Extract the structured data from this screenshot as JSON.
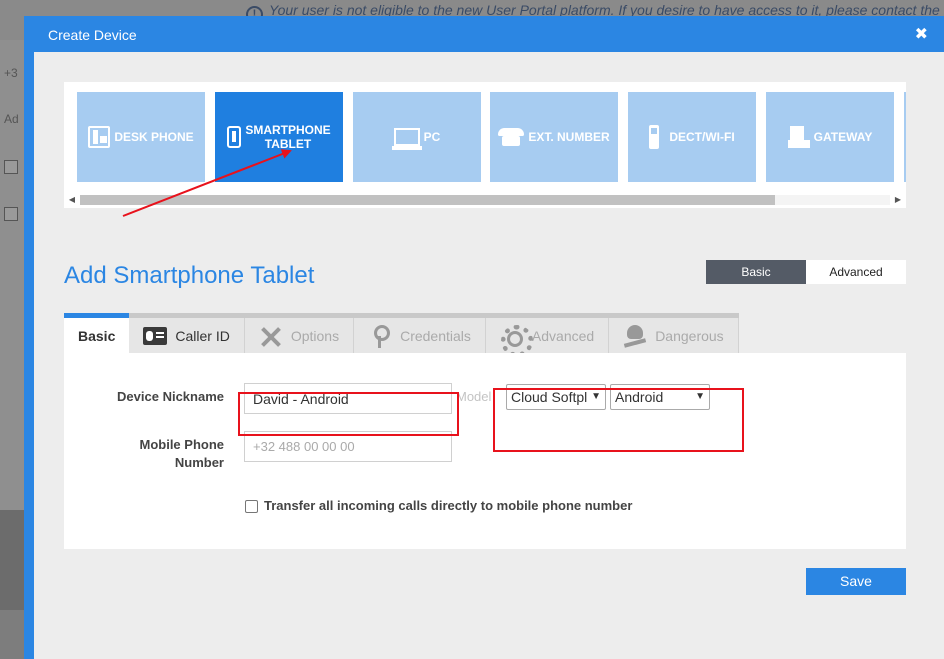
{
  "background": {
    "notice": "Your user is not eligible to the new User Portal platform. If you desire to have access to it, please contact the",
    "left_fragments": [
      "+3",
      "Ad"
    ]
  },
  "modal": {
    "title": "Create Device",
    "close_glyph": "✖"
  },
  "device_types": [
    {
      "label": "DESK PHONE",
      "icon": "desk-phone-icon",
      "active": false
    },
    {
      "label": "SMARTPHONE TABLET",
      "line1": "SMARTPHONE",
      "line2": "TABLET",
      "icon": "smartphone-icon",
      "active": true
    },
    {
      "label": "PC",
      "icon": "pc-icon",
      "active": false
    },
    {
      "label": "EXT. NUMBER",
      "icon": "telephone-icon",
      "active": false
    },
    {
      "label": "DECT/WI-FI",
      "icon": "dect-handset-icon",
      "active": false
    },
    {
      "label": "GATEWAY",
      "icon": "gateway-icon",
      "active": false
    }
  ],
  "scroll": {
    "left_arrow": "◀",
    "right_arrow": "▶"
  },
  "page": {
    "title": "Add Smartphone Tablet",
    "mode_basic": "Basic",
    "mode_advanced": "Advanced"
  },
  "tabs": [
    {
      "label": "Basic",
      "icon": null
    },
    {
      "label": "Caller ID",
      "icon": "contact-card-icon"
    },
    {
      "label": "Options",
      "icon": "tools-icon"
    },
    {
      "label": "Credentials",
      "icon": "key-icon"
    },
    {
      "label": "Advanced",
      "icon": "gear-icon"
    },
    {
      "label": "Dangerous",
      "icon": "skull-icon"
    }
  ],
  "form": {
    "nickname_label": "Device Nickname",
    "nickname_value": "David - Android",
    "model_ghost_label": "Model",
    "brand_select": "Cloud Softphone",
    "brand_select_visible": "Cloud Softpl",
    "os_select": "Android",
    "mobile_label_1": "Mobile Phone",
    "mobile_label_2": "Number",
    "mobile_placeholder": "+32 488 00 00 00",
    "transfer_label": "Transfer all incoming calls directly to mobile phone number",
    "transfer_checked": false
  },
  "save_label": "Save",
  "colors": {
    "accent": "#2b86e3",
    "annotation": "#e8121c",
    "tile_inactive": "#a7ccf1",
    "tile_active": "#1f7fe0"
  }
}
